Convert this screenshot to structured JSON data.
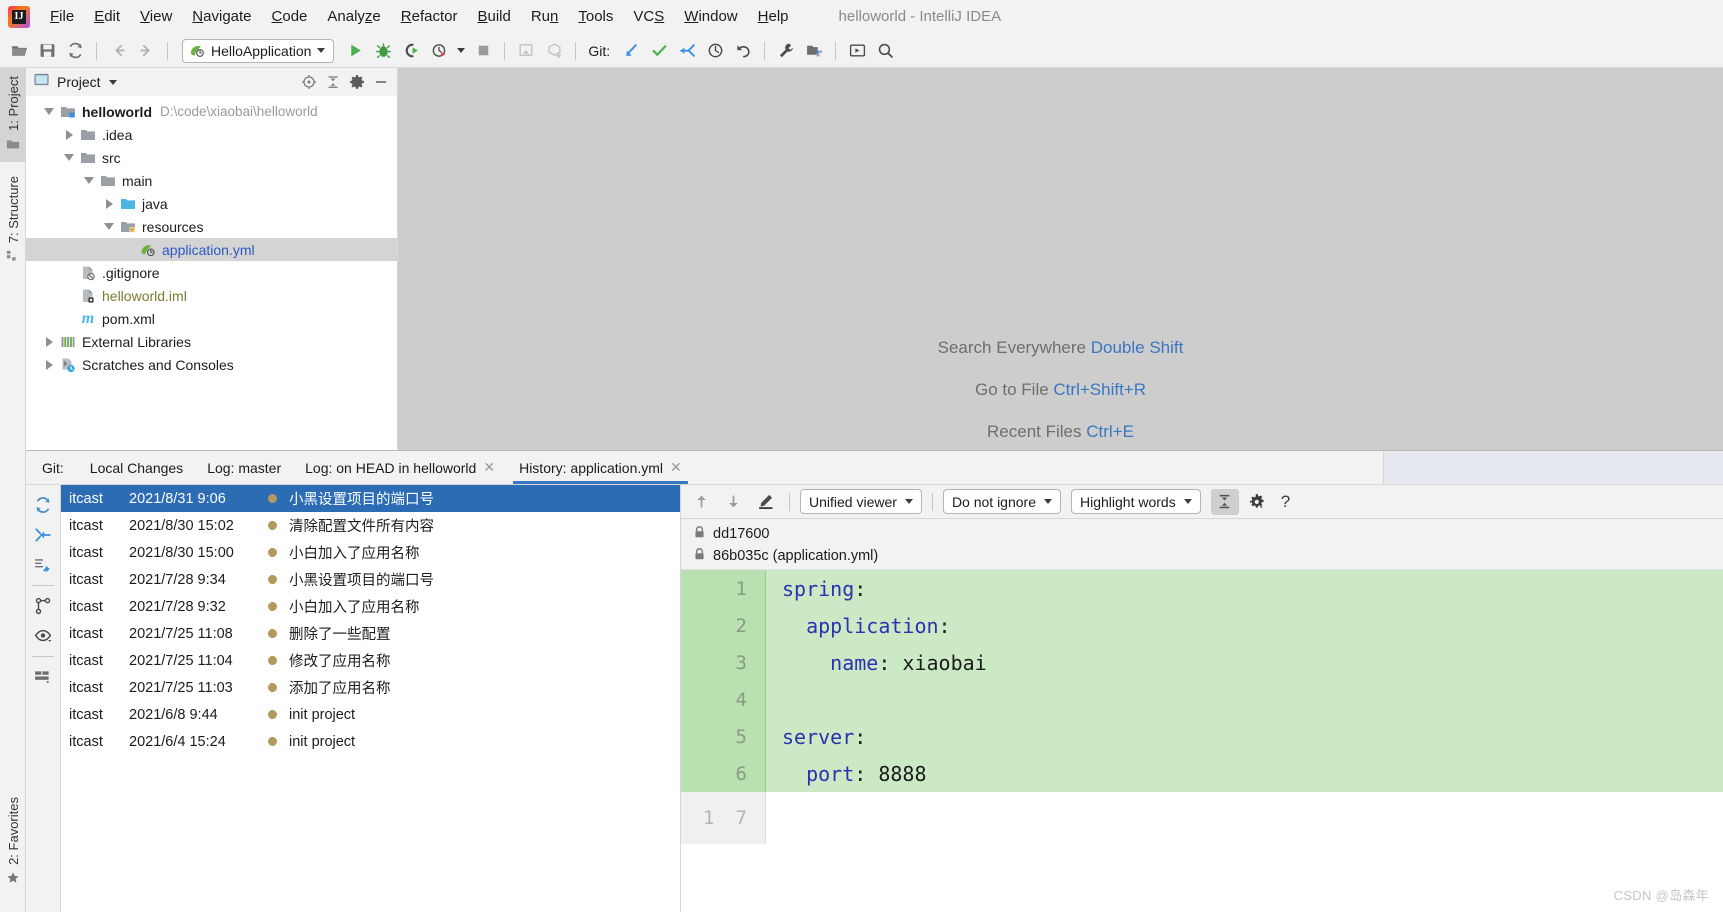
{
  "window": {
    "title": "helloworld - IntelliJ IDEA",
    "logo_text": "IJ"
  },
  "menubar": {
    "items": [
      {
        "label": "File",
        "mnemonic": "F"
      },
      {
        "label": "Edit",
        "mnemonic": "E"
      },
      {
        "label": "View",
        "mnemonic": "V"
      },
      {
        "label": "Navigate",
        "mnemonic": "N"
      },
      {
        "label": "Code",
        "mnemonic": "C"
      },
      {
        "label": "Analyze",
        "mnemonic": "z"
      },
      {
        "label": "Refactor",
        "mnemonic": "R"
      },
      {
        "label": "Build",
        "mnemonic": "B"
      },
      {
        "label": "Run",
        "mnemonic": "n"
      },
      {
        "label": "Tools",
        "mnemonic": "T"
      },
      {
        "label": "VCS",
        "mnemonic": "S"
      },
      {
        "label": "Window",
        "mnemonic": "W"
      },
      {
        "label": "Help",
        "mnemonic": "H"
      }
    ]
  },
  "toolbar": {
    "run_config": "HelloApplication",
    "git_label": "Git:",
    "icons": [
      "open-folder-icon",
      "save-all-icon",
      "sync-refresh-icon",
      "navigate-back-icon",
      "navigate-forward-icon",
      "run-icon",
      "debug-icon",
      "run-with-coverage-icon",
      "profile-icon",
      "stop-icon",
      "deploy-icon",
      "package-icon",
      "git-update-icon",
      "git-commit-icon",
      "git-push-icon",
      "git-history-icon",
      "git-rollback-icon",
      "settings-wrench-icon",
      "project-structure-icon",
      "toggle-tool-window-icon",
      "search-icon"
    ]
  },
  "left_tool_strip": {
    "tabs": [
      {
        "label": "1: Project",
        "icon": "project-folder-icon",
        "active": true
      },
      {
        "label": "7: Structure",
        "icon": "structure-icon",
        "active": false
      },
      {
        "label": "2: Favorites",
        "icon": "star-icon",
        "active": false
      }
    ]
  },
  "project_panel": {
    "title": "Project",
    "toolbar_icons": [
      "scroll-from-source-icon",
      "collapse-all-icon",
      "gear-icon",
      "hide-icon"
    ],
    "tree": [
      {
        "depth": 0,
        "twisty": "open",
        "icon": "module-folder-icon",
        "label": "helloworld",
        "bold": true,
        "path": "D:\\code\\xiaobai\\helloworld",
        "selected": false
      },
      {
        "depth": 1,
        "twisty": "closed",
        "icon": "folder-icon",
        "label": ".idea",
        "bold": false,
        "path": "",
        "selected": false
      },
      {
        "depth": 1,
        "twisty": "open",
        "icon": "folder-icon",
        "label": "src",
        "bold": false,
        "path": "",
        "selected": false
      },
      {
        "depth": 2,
        "twisty": "open",
        "icon": "folder-icon",
        "label": "main",
        "bold": false,
        "path": "",
        "selected": false
      },
      {
        "depth": 3,
        "twisty": "closed",
        "icon": "source-root-icon",
        "label": "java",
        "bold": false,
        "path": "",
        "selected": false
      },
      {
        "depth": 3,
        "twisty": "open",
        "icon": "resource-root-icon",
        "label": "resources",
        "bold": false,
        "path": "",
        "selected": false
      },
      {
        "depth": 4,
        "twisty": "none",
        "icon": "spring-yml-icon",
        "label": "application.yml",
        "bold": false,
        "path": "",
        "selected": true,
        "color": "blue"
      },
      {
        "depth": 1,
        "twisty": "none",
        "icon": "gitignore-icon",
        "label": ".gitignore",
        "bold": false,
        "path": "",
        "selected": false
      },
      {
        "depth": 1,
        "twisty": "none",
        "icon": "iml-file-icon",
        "label": "helloworld.iml",
        "bold": false,
        "path": "",
        "selected": false,
        "color": "olive"
      },
      {
        "depth": 1,
        "twisty": "none",
        "icon": "maven-pom-icon",
        "label": "pom.xml",
        "bold": false,
        "path": "",
        "selected": false
      },
      {
        "depth": 0,
        "twisty": "closed",
        "icon": "external-libraries-icon",
        "label": "External Libraries",
        "bold": false,
        "path": "",
        "selected": false
      },
      {
        "depth": 0,
        "twisty": "closed",
        "icon": "scratches-icon",
        "label": "Scratches and Consoles",
        "bold": false,
        "path": "",
        "selected": false
      }
    ]
  },
  "editor_welcome": {
    "lines": [
      {
        "text": "Search Everywhere ",
        "key": "Double Shift"
      },
      {
        "text": "Go to File ",
        "key": "Ctrl+Shift+R"
      },
      {
        "text": "Recent Files ",
        "key": "Ctrl+E"
      }
    ]
  },
  "git_panel": {
    "label": "Git:",
    "tabs": [
      {
        "label": "Local Changes",
        "closable": false,
        "active": false
      },
      {
        "label": "Log: master",
        "closable": false,
        "active": false
      },
      {
        "label": "Log: on HEAD in helloworld",
        "closable": true,
        "active": false
      },
      {
        "label": "History: application.yml",
        "closable": true,
        "active": true
      }
    ],
    "side_icons": [
      "refresh-icon",
      "collapse-branches-icon",
      "expand-all-icon",
      "show-branches-icon",
      "show-details-icon",
      "show-diff-preview-icon"
    ],
    "commits": [
      {
        "author": "itcast",
        "date": "2021/8/31 9:06",
        "message": "小黑设置项目的端口号",
        "selected": true
      },
      {
        "author": "itcast",
        "date": "2021/8/30 15:02",
        "message": "清除配置文件所有内容",
        "selected": false
      },
      {
        "author": "itcast",
        "date": "2021/8/30 15:00",
        "message": "小白加入了应用名称",
        "selected": false
      },
      {
        "author": "itcast",
        "date": "2021/7/28 9:34",
        "message": "小黑设置项目的端口号",
        "selected": false
      },
      {
        "author": "itcast",
        "date": "2021/7/28 9:32",
        "message": "小白加入了应用名称",
        "selected": false
      },
      {
        "author": "itcast",
        "date": "2021/7/25 11:08",
        "message": "删除了一些配置",
        "selected": false
      },
      {
        "author": "itcast",
        "date": "2021/7/25 11:04",
        "message": "修改了应用名称",
        "selected": false
      },
      {
        "author": "itcast",
        "date": "2021/7/25 11:03",
        "message": "添加了应用名称",
        "selected": false
      },
      {
        "author": "itcast",
        "date": "2021/6/8 9:44",
        "message": "init project",
        "selected": false
      },
      {
        "author": "itcast",
        "date": "2021/6/4 15:24",
        "message": "init project",
        "selected": false
      }
    ]
  },
  "diff": {
    "toolbar": {
      "prev_icon": "arrow-up-icon",
      "next_icon": "arrow-down-icon",
      "edit_icon": "edit-source-icon",
      "viewer_mode": "Unified viewer",
      "whitespace": "Do not ignore",
      "highlight": "Highlight words",
      "collapse_icon": "collapse-unchanged-icon",
      "settings_icon": "gear-icon",
      "help_icon": "help-icon",
      "help_label": "?"
    },
    "revisions": [
      {
        "icon": "lock-icon",
        "label": "dd17600"
      },
      {
        "icon": "lock-icon",
        "label": "86b035c (application.yml)"
      }
    ],
    "code_lines": [
      {
        "num": "1",
        "text": "spring:",
        "kw": "spring",
        "rest": ":",
        "added": true
      },
      {
        "num": "2",
        "text": "  application:",
        "kw": "  application",
        "rest": ":",
        "added": true
      },
      {
        "num": "3",
        "text": "    name: xiaobai",
        "kw": "    name",
        "rest": ": xiaobai",
        "added": true
      },
      {
        "num": "4",
        "text": "",
        "kw": "",
        "rest": "",
        "added": true
      },
      {
        "num": "5",
        "text": "server:",
        "kw": "server",
        "rest": ":",
        "added": true
      },
      {
        "num": "6",
        "text": "  port: 8888",
        "kw": "  port",
        "rest": ": 8888",
        "added": true
      }
    ],
    "last_gutter_left": "1",
    "last_gutter_right": "7"
  },
  "watermark": "CSDN @岛森年"
}
